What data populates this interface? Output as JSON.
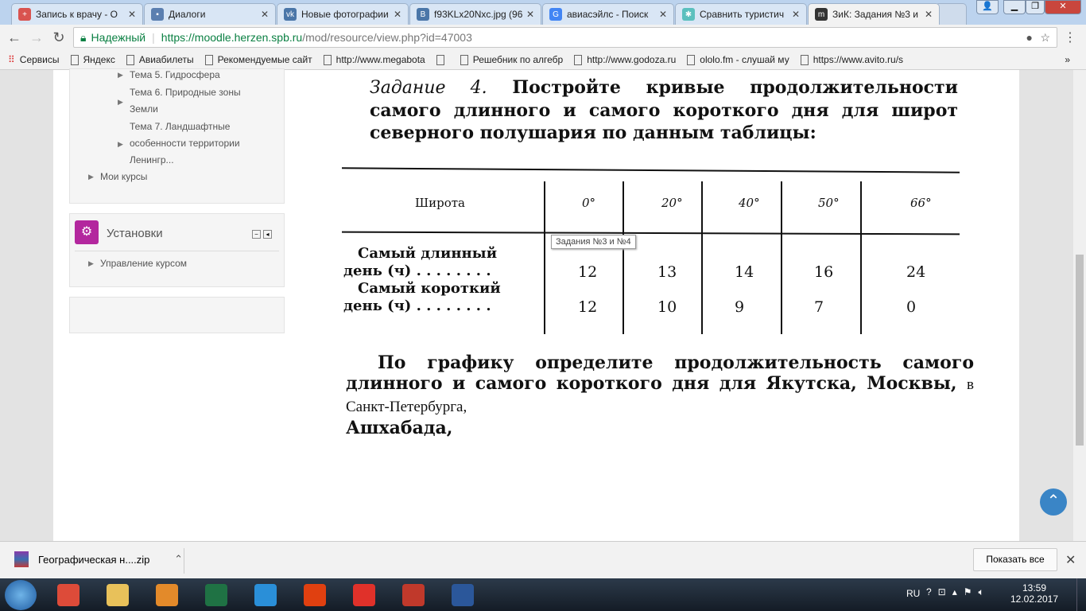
{
  "tabs": [
    {
      "title": "Запись к врачу - О",
      "color": "#d9534f",
      "glyph": "+"
    },
    {
      "title": "Диалоги",
      "color": "#5b7fb0",
      "glyph": "▪"
    },
    {
      "title": "Новые фотографии",
      "color": "#4a76a8",
      "glyph": "vk"
    },
    {
      "title": "f93KLx20Nxc.jpg (96",
      "color": "#4a76a8",
      "glyph": "B"
    },
    {
      "title": "авиасэйлс - Поиск",
      "color": "#4285f4",
      "glyph": "G"
    },
    {
      "title": "Сравнить туристич",
      "color": "#5bc0be",
      "glyph": "✱"
    },
    {
      "title": "ЗиК: Задания №3 и",
      "color": "#333",
      "glyph": "m"
    }
  ],
  "address": {
    "secure_label": "Надежный",
    "url_host": "https://moodle.herzen.spb.ru",
    "url_path": "/mod/resource/view.php?id=47003"
  },
  "bookmarks": [
    "Сервисы",
    "Яндекс",
    "Авиабилеты",
    "Рекомендуемые сайт",
    "http://www.megabota",
    "",
    "Решебник по алгебр",
    "http://www.godoza.ru",
    "ololo.fm - слушай му",
    "https://www.avito.ru/s"
  ],
  "sidebar": {
    "topics": [
      "Тема 5. Гидросфера",
      "Тема 6. Природные зоны Земли",
      "Тема 7. Ландшафтные особенности территории Ленингр..."
    ],
    "my_courses": "Мои курсы",
    "settings_title": "Установки",
    "manage_course": "Управление курсом"
  },
  "document": {
    "task_label": "Задание 4.",
    "task_text": "Постройте кривые продолжительности самого длинного и самого короткого дня для широт северного полушария по данным таблицы:",
    "table": {
      "header": [
        "Широта",
        "0°",
        "20°",
        "40°",
        "50°",
        "66°"
      ],
      "rows": [
        {
          "label": "Самый длинный день (ч) . . . . . . . .",
          "values": [
            "12",
            "13",
            "14",
            "16",
            "24"
          ]
        },
        {
          "label": "Самый короткий день (ч) . . . . . . . .",
          "values": [
            "12",
            "10",
            "9",
            "7",
            "0"
          ]
        }
      ]
    },
    "question": "По графику определите продолжительность самого длинного и самого короткого дня для Якутска, Москвы,",
    "question_handwritten": "в Санкт-Петербурга,",
    "question_end": "Ашхабада,"
  },
  "tooltip": "Задания №3 и №4",
  "download": {
    "file": "Географическая н....zip",
    "show_all": "Показать все"
  },
  "tray": {
    "lang": "RU",
    "time": "13:59",
    "date": "12.02.2017"
  }
}
